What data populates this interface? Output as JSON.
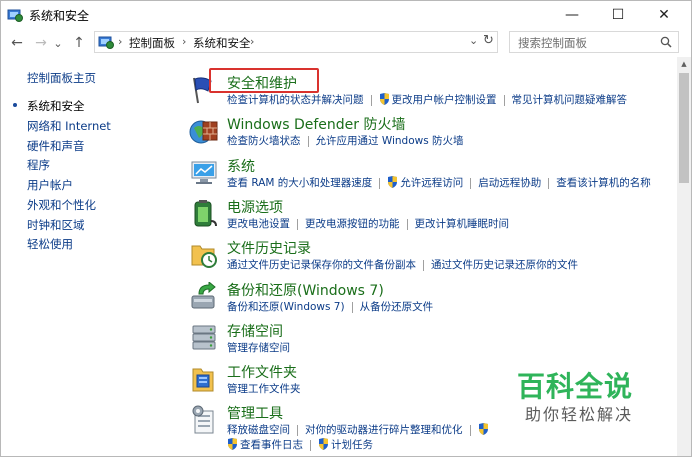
{
  "window": {
    "title": "系统和安全"
  },
  "controls": {
    "minimize": "—",
    "maximize": "☐",
    "close": "✕"
  },
  "nav": {
    "back": "←",
    "forward": "→",
    "recent": "⌄",
    "up": "↑",
    "dropdown": "⌄",
    "refresh": "↻"
  },
  "address": {
    "crumbs": [
      "控制面板",
      "系统和安全"
    ],
    "separator": "›"
  },
  "search": {
    "placeholder": "搜索控制面板",
    "icon": "search-icon"
  },
  "sidebar": {
    "home": "控制面板主页",
    "items": [
      "系统和安全",
      "网络和 Internet",
      "硬件和声音",
      "程序",
      "用户帐户",
      "外观和个性化",
      "时钟和区域",
      "轻松使用"
    ],
    "current_index": 0
  },
  "categories": [
    {
      "title": "安全和维护",
      "icon": "flag-icon",
      "links": [
        "检查计算机的状态并解决问题",
        "更改用户帐户控制设置",
        "常见计算机问题疑难解答"
      ]
    },
    {
      "title": "Windows Defender 防火墙",
      "icon": "firewall-icon",
      "links": [
        "检查防火墙状态",
        "允许应用通过 Windows 防火墙"
      ]
    },
    {
      "title": "系统",
      "icon": "computer-icon",
      "links": [
        "查看 RAM 的大小和处理器速度",
        "允许远程访问",
        "启动远程协助",
        "查看该计算机的名称"
      ]
    },
    {
      "title": "电源选项",
      "icon": "battery-icon",
      "links": [
        "更改电池设置",
        "更改电源按钮的功能",
        "更改计算机睡眠时间"
      ]
    },
    {
      "title": "文件历史记录",
      "icon": "file-history-icon",
      "links": [
        "通过文件历史记录保存你的文件备份副本",
        "通过文件历史记录还原你的文件"
      ]
    },
    {
      "title": "备份和还原(Windows 7)",
      "icon": "backup-icon",
      "links": [
        "备份和还原(Windows 7)",
        "从备份还原文件"
      ]
    },
    {
      "title": "存储空间",
      "icon": "storage-icon",
      "links": [
        "管理存储空间"
      ]
    },
    {
      "title": "工作文件夹",
      "icon": "folder-icon",
      "links": [
        "管理工作文件夹"
      ]
    },
    {
      "title": "管理工具",
      "icon": "tools-icon",
      "links": [
        "释放磁盘空间",
        "对你的驱动器进行碎片整理和优化",
        "查看事件日志",
        "计划任务"
      ]
    }
  ],
  "watermark": {
    "main": "百科全说",
    "sub": "助你轻松解决"
  },
  "colors": {
    "link": "#0c3c88",
    "category_title": "#1a6e1a",
    "highlight": "#d9322e",
    "watermark": "#2fb45a"
  }
}
